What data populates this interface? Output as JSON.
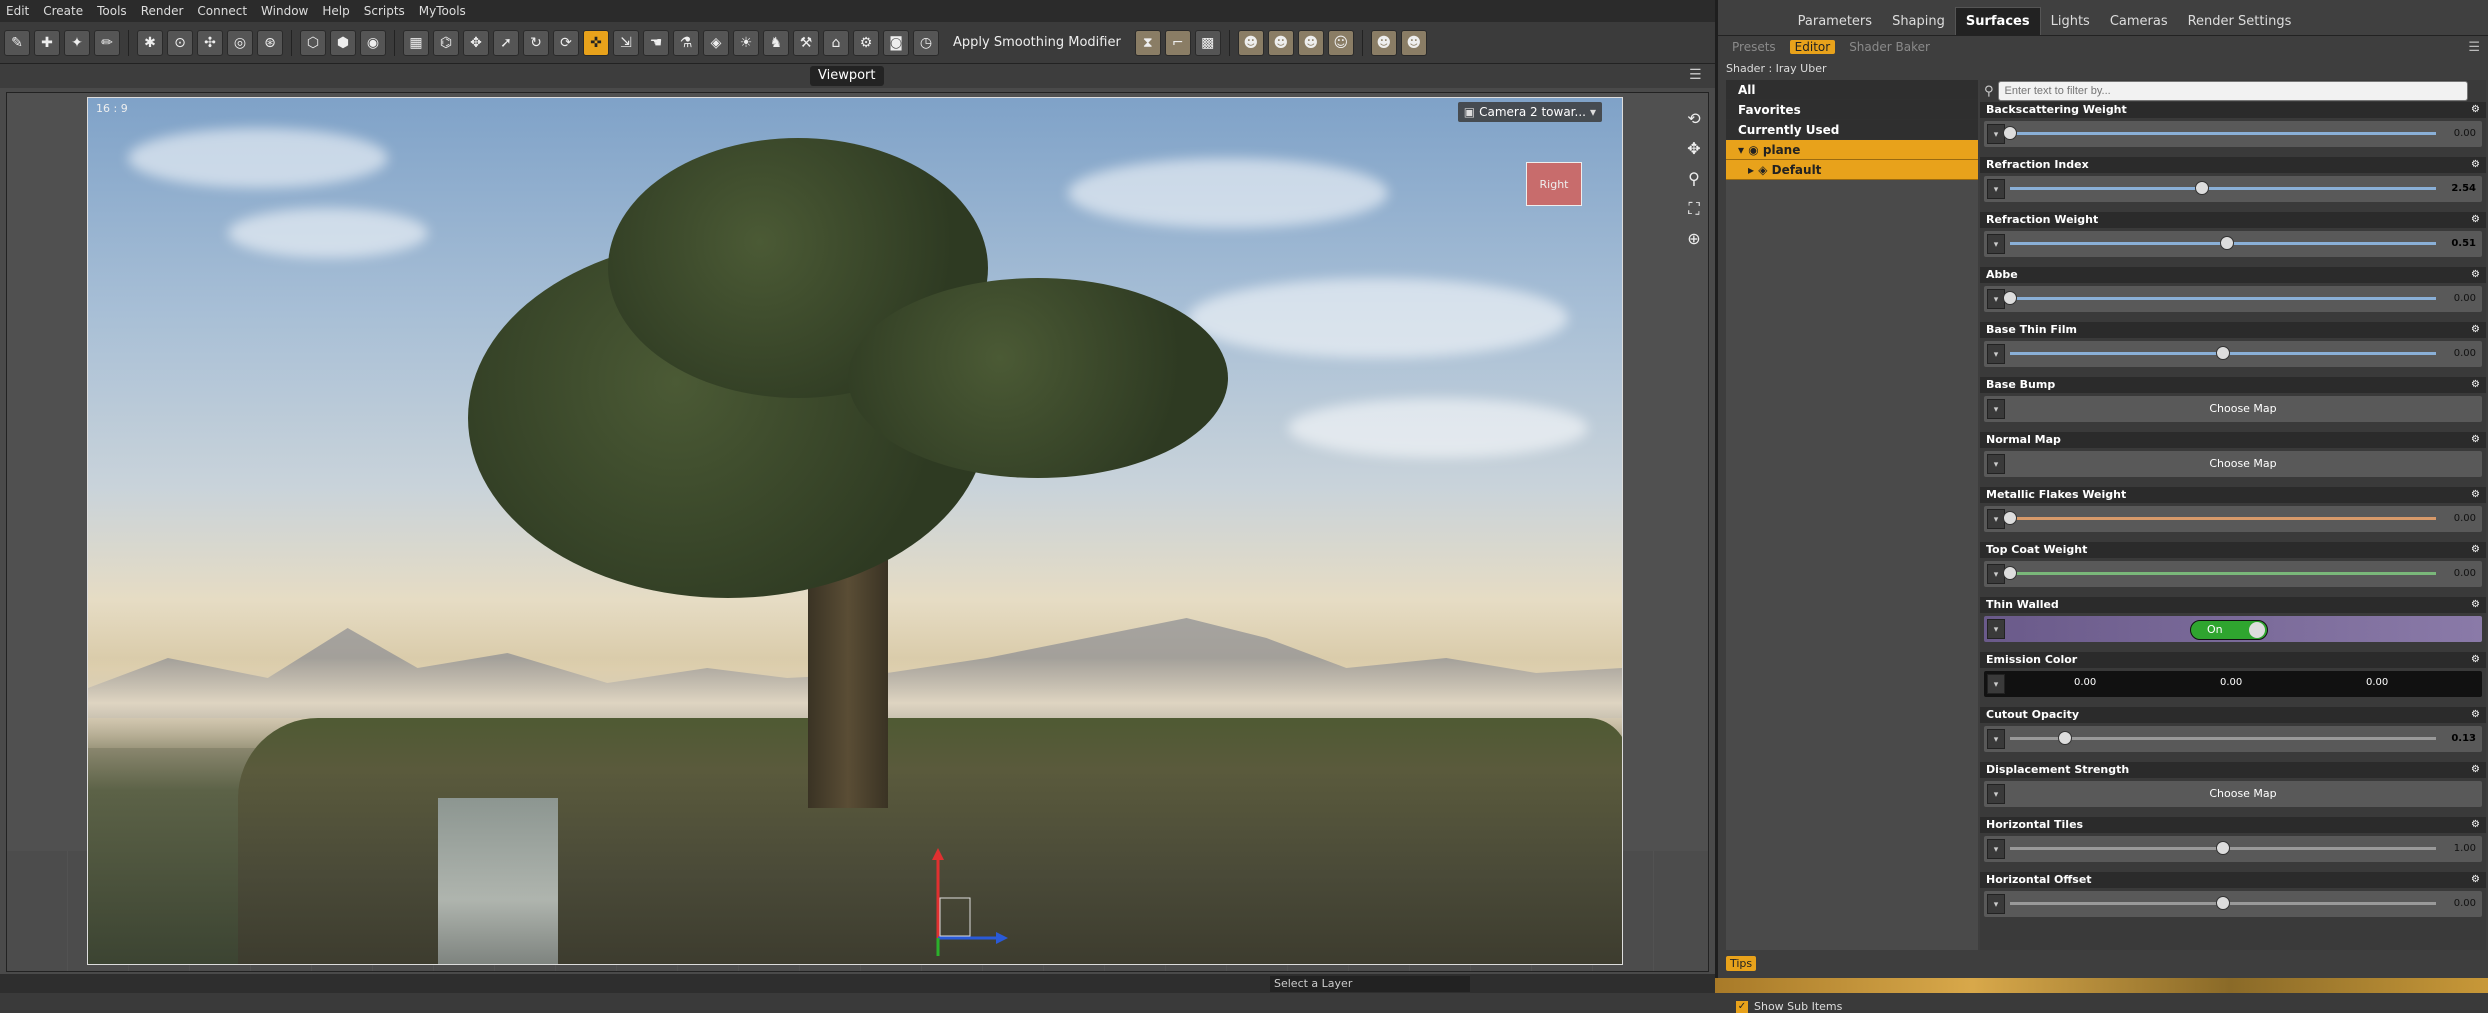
{
  "menubar": [
    "Edit",
    "Create",
    "Tools",
    "Render",
    "Connect",
    "Window",
    "Help",
    "Scripts",
    "MyTools"
  ],
  "toolbar": {
    "smoothing_label": "Apply Smoothing Modifier"
  },
  "viewport": {
    "tab": "Viewport",
    "aspect": "16 : 9",
    "camera": "Camera 2 towar...",
    "view_cube": "Right"
  },
  "panel": {
    "main_tabs": [
      "Parameters",
      "Shaping",
      "Surfaces",
      "Lights",
      "Cameras",
      "Render Settings"
    ],
    "active_main_tab": "Surfaces",
    "sub_tabs": [
      "Presets",
      "Editor",
      "Shader Baker"
    ],
    "shader": "Shader : Iray Uber",
    "tree": [
      "All",
      "Favorites",
      "Currently Used",
      "plane",
      "Default"
    ],
    "filter_placeholder": "Enter text to filter by...",
    "show_sub_items": "Show Sub Items",
    "tips": "Tips",
    "props": [
      {
        "label": "Backscattering Weight",
        "type": "slider",
        "value": "0.00",
        "pct": 0.0,
        "color": "blue"
      },
      {
        "label": "Refraction Index",
        "type": "slider",
        "value": "2.54",
        "pct": 0.45,
        "color": "blue",
        "hl": true
      },
      {
        "label": "Refraction Weight",
        "type": "slider",
        "value": "0.51",
        "pct": 0.51,
        "color": "blue",
        "hl": true
      },
      {
        "label": "Abbe",
        "type": "slider",
        "value": "0.00",
        "pct": 0.0,
        "color": "blue"
      },
      {
        "label": "Base Thin Film",
        "type": "slider",
        "value": "0.00",
        "pct": 0.5,
        "color": "blue"
      },
      {
        "label": "Base Bump",
        "type": "map",
        "value": "Choose Map"
      },
      {
        "label": "Normal Map",
        "type": "map",
        "value": "Choose Map"
      },
      {
        "label": "Metallic Flakes Weight",
        "type": "slider",
        "value": "0.00",
        "pct": 0.0,
        "color": "orange"
      },
      {
        "label": "Top Coat Weight",
        "type": "slider",
        "value": "0.00",
        "pct": 0.0,
        "color": "green"
      },
      {
        "label": "Thin Walled",
        "type": "toggle",
        "value": "On"
      },
      {
        "label": "Emission Color",
        "type": "color",
        "values": [
          "0.00",
          "0.00",
          "0.00"
        ]
      },
      {
        "label": "Cutout Opacity",
        "type": "slider",
        "value": "0.13",
        "pct": 0.13,
        "color": "grey",
        "hl": true
      },
      {
        "label": "Displacement Strength",
        "type": "map",
        "value": "Choose Map"
      },
      {
        "label": "Horizontal Tiles",
        "type": "slider",
        "value": "1.00",
        "pct": 0.5,
        "color": "grey"
      },
      {
        "label": "Horizontal Offset",
        "type": "slider",
        "value": "0.00",
        "pct": 0.5,
        "color": "grey"
      }
    ]
  },
  "layers": {
    "select_label": "Select a Layer"
  }
}
